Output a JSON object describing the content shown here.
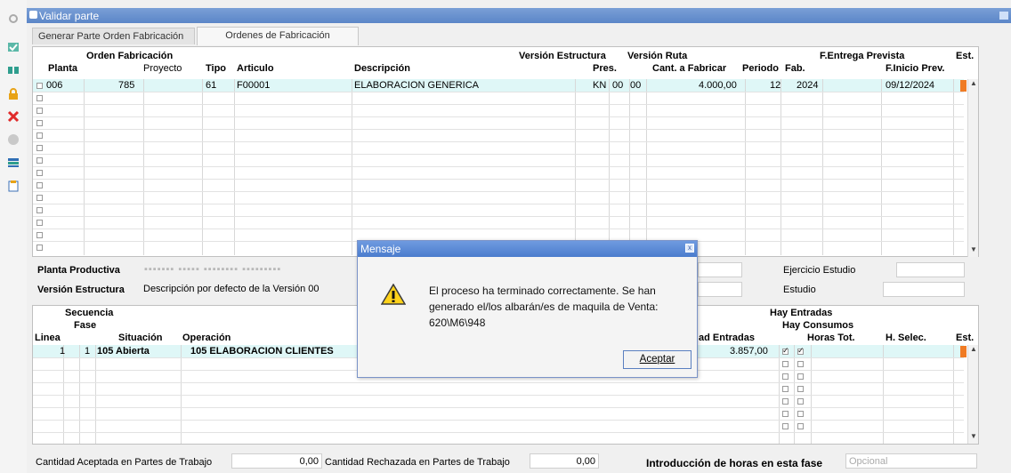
{
  "window": {
    "title": "Validar parte"
  },
  "tabs": [
    {
      "label": "Generar Parte Orden Fabricación"
    },
    {
      "label": "Ordenes de Fabricación"
    }
  ],
  "orders_grid": {
    "headers": {
      "orden_fabricacion": "Orden Fabricación",
      "planta": "Planta",
      "proyecto": "Proyecto",
      "tipo": "Tipo",
      "articulo": "Articulo",
      "descripcion": "Descripción",
      "version_estructura": "Versión Estructura",
      "pres": "Pres.",
      "version_ruta": "Versión Ruta",
      "cant_fabricar": "Cant. a Fabricar",
      "periodo": "Periodo",
      "fab": "Fab.",
      "f_entrega_prevista": "F.Entrega Prevista",
      "f_inicio_prev": "F.Inicio Prev.",
      "est": "Est."
    },
    "row": {
      "planta": "006",
      "proyecto": "785",
      "tipo": "61",
      "articulo": "F00001",
      "descripcion": "ELABORACION GENERICA",
      "pres": "KN",
      "version_estructura": "00",
      "version_ruta": "00",
      "cant_fabricar": "4.000,00",
      "periodo": "12",
      "fab": "2024",
      "f_inicio_prev": "09/12/2024"
    }
  },
  "detail": {
    "planta_productiva_label": "Planta Productiva",
    "version_estructura_label": "Versión Estructura",
    "version_estructura_value": "Descripción por defecto de la Versión 00",
    "ejercicio_estudio_label": "Ejercicio Estudio",
    "estudio_label": "Estudio"
  },
  "operations_grid": {
    "headers": {
      "secuencia": "Secuencia",
      "fase": "Fase",
      "linea": "Linea",
      "situacion": "Situación",
      "operacion": "Operación",
      "cantidad_entradas": "ad Entradas",
      "hay_entradas": "Hay Entradas",
      "hay_consumos": "Hay Consumos",
      "horas_tot": "Horas Tot.",
      "h_selec": "H. Selec.",
      "est": "Est."
    },
    "row": {
      "linea": "1",
      "fase": "1",
      "situacion": "105 Abierta",
      "operacion": "105 ELABORACION CLIENTES",
      "cantidad_entradas": "3.857,00"
    }
  },
  "footer": {
    "cantidad_aceptada_label": "Cantidad Aceptada en Partes de Trabajo",
    "cantidad_aceptada_value": "0,00",
    "cantidad_rechazada_label": "Cantidad Rechazada en Partes de Trabajo",
    "cantidad_rechazada_value": "0,00",
    "introduccion_label": "Introducción de horas en esta fase",
    "introduccion_value": "Opcional"
  },
  "dialog": {
    "title": "Mensaje",
    "message_line1": "El proceso ha terminado correctamente. Se han",
    "message_line2": "generado el/los albarán/es de maquila de Venta:",
    "message_line3": "620\\M6\\948",
    "ok_label": "Aceptar",
    "close_glyph": "x"
  },
  "colors": {
    "selected_row": "#dff7f7",
    "status_orange": "#f07b24",
    "titlebar": "#5b86c8"
  }
}
